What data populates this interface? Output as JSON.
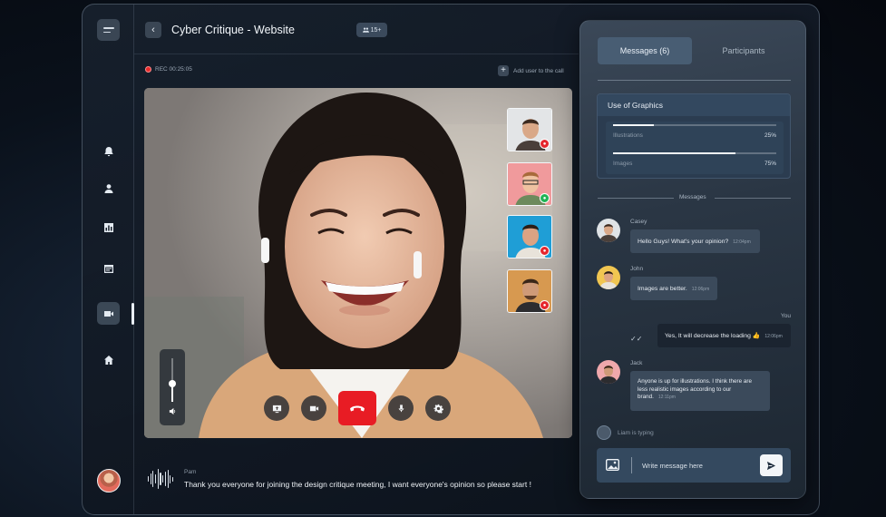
{
  "app": {
    "title": "Cyber Critique - Website",
    "participants_badge": "15+",
    "back_icon": "chevron-left-icon"
  },
  "sidebar": {
    "items": [
      {
        "name": "notifications",
        "icon": "bell-icon"
      },
      {
        "name": "profile",
        "icon": "user-icon"
      },
      {
        "name": "analytics",
        "icon": "bar-chart-icon"
      },
      {
        "name": "calendar",
        "icon": "calendar-icon"
      },
      {
        "name": "video-call",
        "icon": "video-icon",
        "active": true
      },
      {
        "name": "home",
        "icon": "home-icon"
      }
    ]
  },
  "call": {
    "recording_label": "REC 00:25:05",
    "add_user_label": "Add user to the call",
    "volume_level": 0.42,
    "participants": [
      {
        "name": "participant-1",
        "badge": "mic-off",
        "badge_color": "#e5262d"
      },
      {
        "name": "participant-2",
        "badge": "mic-on",
        "badge_color": "#20b455"
      },
      {
        "name": "participant-3",
        "badge": "mic-off",
        "badge_color": "#e5262d"
      },
      {
        "name": "participant-4",
        "badge": "mic-off",
        "badge_color": "#e5262d"
      }
    ],
    "controls": [
      "screen-share-icon",
      "video-icon",
      "end-call-icon",
      "mic-icon",
      "settings-icon"
    ],
    "caption": {
      "speaker": "Pam",
      "text": "Thank you everyone for joining the design critique meeting, I want everyone's opinion so please start !"
    }
  },
  "panel": {
    "tabs": [
      {
        "label": "Messages (6)",
        "active": true
      },
      {
        "label": "Participants",
        "active": false
      }
    ],
    "graphics_card": {
      "title": "Use of Graphics",
      "items": [
        {
          "label": "Illustrations",
          "percent_label": "25%",
          "value": 0.25
        },
        {
          "label": "Images",
          "percent_label": "75%",
          "value": 0.75
        }
      ]
    },
    "messages_divider": "Messages",
    "messages": [
      {
        "sender": "Casey",
        "text": "Hello Guys! What's your opinion?",
        "time": "12:04pm"
      },
      {
        "sender": "John",
        "text": "Images are better.",
        "time": "12:06pm"
      },
      {
        "sender": "You",
        "text": "Yes, It will decrease the loading 👍",
        "time": "12:06pm"
      },
      {
        "sender": "Jack",
        "text": "Anyone is up for illustrations. I think there are less realistic images according to our brand.",
        "time": "12:11pm"
      }
    ],
    "typing_text": "Liam is typing",
    "composer": {
      "placeholder": "Write message here"
    }
  },
  "colors": {
    "accent_red": "#e81c24",
    "tab_active": "#485d73",
    "panel_bg": "#2a3644"
  }
}
